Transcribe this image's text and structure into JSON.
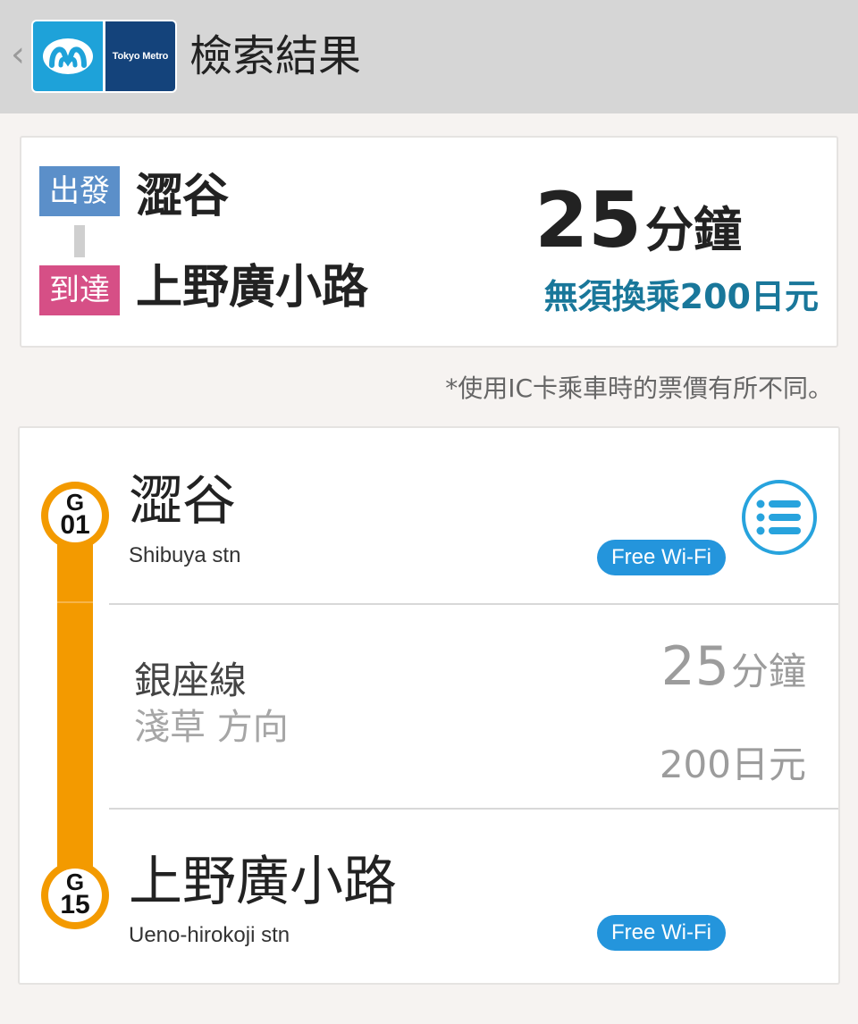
{
  "header": {
    "back_icon": "chevron-left-icon",
    "logo_text": "Tokyo Metro",
    "title": "檢索結果"
  },
  "summary": {
    "depart_tag": "出發",
    "arrive_tag": "到達",
    "from_station": "澀谷",
    "to_station": "上野廣小路",
    "duration_value": "25",
    "duration_unit": "分鐘",
    "fare_text": "無須換乘200日元"
  },
  "ic_note": "*使用IC卡乘車時的票價有所不同。",
  "route": {
    "line_color": "#f39a00",
    "from": {
      "badge_letter": "G",
      "badge_number": "01",
      "name": "澀谷",
      "name_en": "Shibuya stn",
      "wifi": "Free Wi-Fi"
    },
    "segment": {
      "line_name": "銀座線",
      "direction": "淺草 方向",
      "duration_value": "25",
      "duration_unit": "分鐘",
      "fare": "200日元"
    },
    "to": {
      "badge_letter": "G",
      "badge_number": "15",
      "name": "上野廣小路",
      "name_en": "Ueno-hirokoji stn",
      "wifi": "Free Wi-Fi"
    },
    "menu_icon": "list-icon"
  }
}
